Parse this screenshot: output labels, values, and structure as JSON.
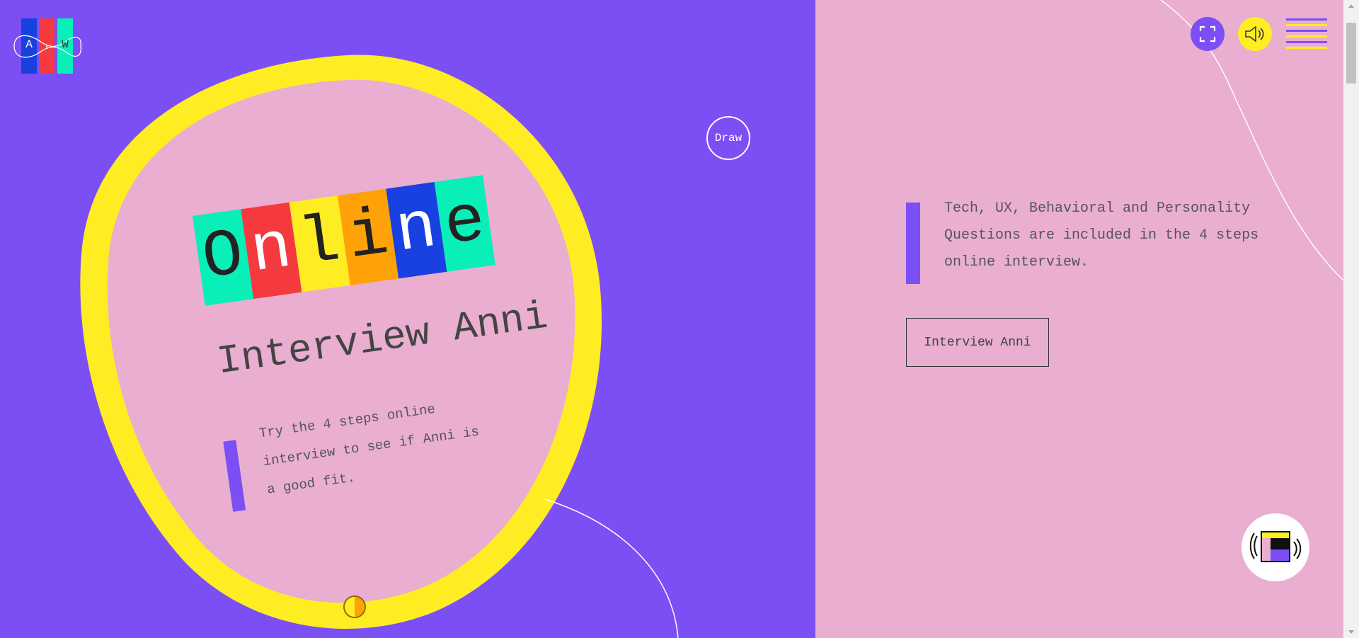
{
  "logo": {
    "letters": [
      "A",
      ".",
      "W"
    ],
    "colors": [
      "#1940e0",
      "#f43a3f",
      "#08efb8"
    ]
  },
  "draw_button": {
    "label": "Draw"
  },
  "hero": {
    "word_letters": [
      "O",
      "n",
      "l",
      "i",
      "n",
      "e"
    ],
    "word_colors": [
      "#08efb8",
      "#f43a3f",
      "#ffed24",
      "#ffa208",
      "#1940e0",
      "#08efb8"
    ],
    "title": "Interview Anni",
    "description": "Try the 4 steps online interview to see if Anni is a good fit."
  },
  "theme_toggle": {
    "icon": "half-circle-toggle-icon"
  },
  "info": {
    "text": "Tech, UX, Behavioral and Personality Questions are included in the 4 steps online interview.",
    "button_label": "Interview Anni"
  },
  "controls": {
    "fullscreen_icon": "fullscreen-icon",
    "sound_icon": "speaker-icon",
    "menu_icon": "hamburger-menu-icon",
    "audio_widget_icon": "audio-player-icon"
  },
  "colors": {
    "purple": "#7b4ff4",
    "pink": "#e9aed0",
    "yellow": "#ffed24",
    "orange": "#ffa208",
    "blue": "#1940e0",
    "red": "#f43a3f",
    "mint": "#08efb8"
  }
}
